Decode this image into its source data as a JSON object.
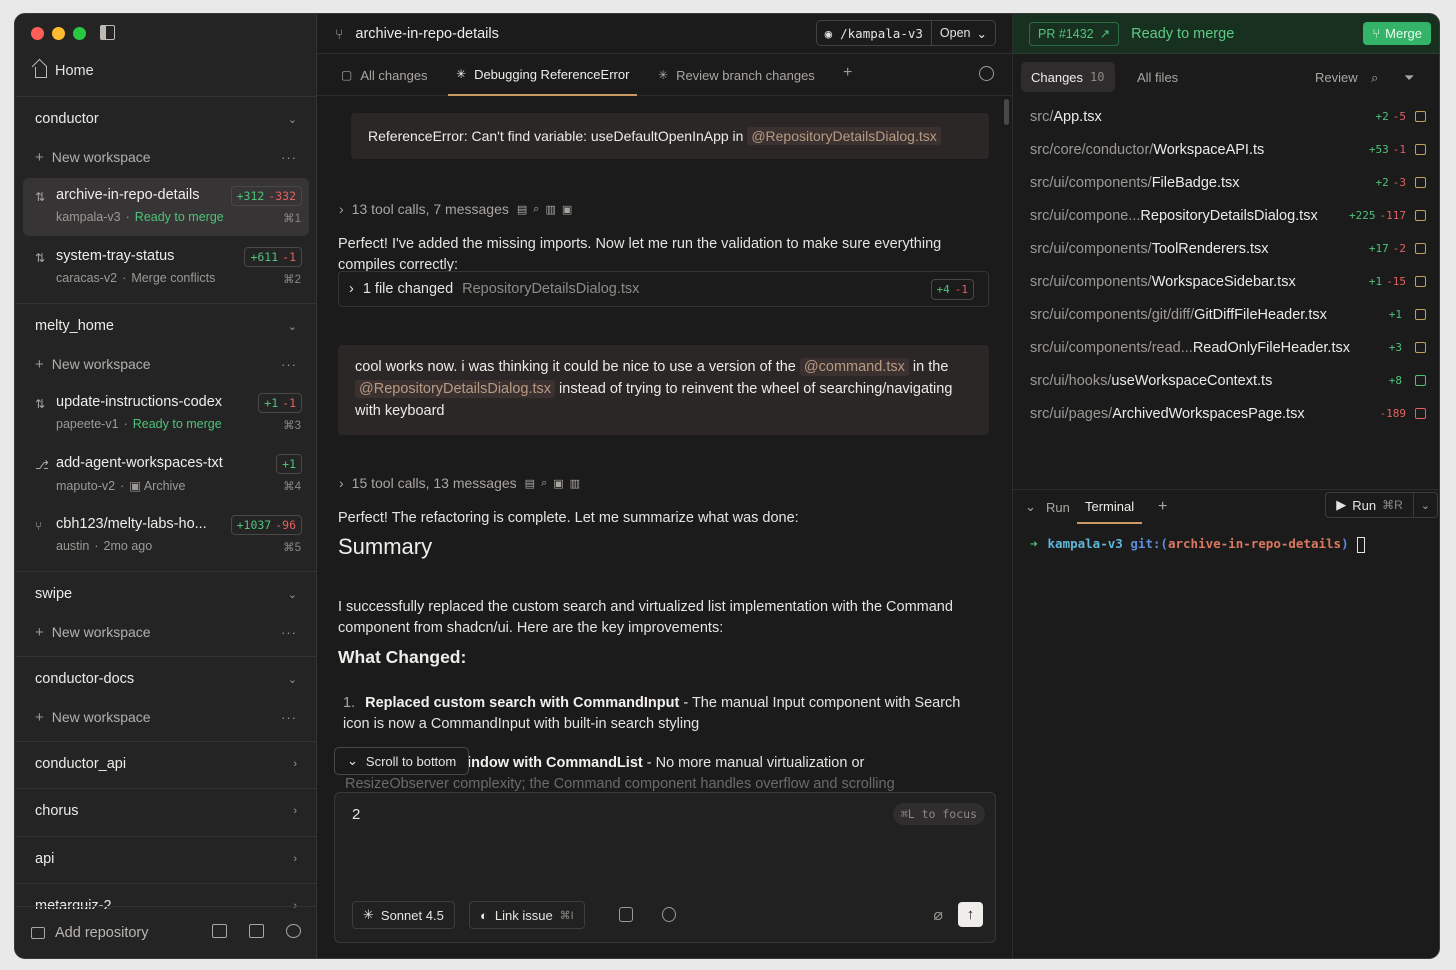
{
  "sidebar": {
    "home_label": "Home",
    "repos": [
      {
        "name": "conductor",
        "new_workspace": "New workspace",
        "workspaces": [
          {
            "title": "archive-in-repo-details",
            "sub": "kampala-v3",
            "status": "Ready to merge",
            "add": "+312",
            "del": "-332",
            "shortcut": "⌘1"
          },
          {
            "title": "system-tray-status",
            "sub": "caracas-v2",
            "status": "Merge conflicts",
            "add": "+611",
            "del": "-1",
            "shortcut": "⌘2"
          }
        ]
      },
      {
        "name": "melty_home",
        "new_workspace": "New workspace",
        "workspaces": [
          {
            "title": "update-instructions-codex",
            "sub": "papeete-v1",
            "status": "Ready to merge",
            "add": "+1",
            "del": "-1",
            "shortcut": "⌘3"
          },
          {
            "title": "add-agent-workspaces-txt",
            "sub": "maputo-v2",
            "status": "Archive",
            "add": "+1",
            "shortcut": "⌘4"
          },
          {
            "title": "cbh123/melty-labs-ho...",
            "sub": "austin",
            "status": "2mo ago",
            "add": "+1037",
            "del": "-96",
            "shortcut": "⌘5"
          }
        ]
      },
      {
        "name": "swipe",
        "new_workspace": "New workspace"
      },
      {
        "name": "conductor-docs",
        "new_workspace": "New workspace"
      },
      {
        "name": "conductor_api"
      },
      {
        "name": "chorus"
      },
      {
        "name": "api"
      },
      {
        "name": "metarquiz-2"
      }
    ],
    "add_repository": "Add repository"
  },
  "middle": {
    "title": "archive-in-repo-details",
    "branch": "/kampala-v3",
    "open_label": "Open",
    "tabs": [
      "All changes",
      "Debugging ReferenceError",
      "Review branch changes"
    ],
    "error_text": "ReferenceError: Can't find variable: useDefaultOpenInApp in",
    "error_ref": "@RepositoryDetailsDialog.tsx",
    "toolcalls_1": "13 tool calls, 7 messages",
    "assistant_1": "Perfect! I've added the missing imports. Now let me run the validation to make sure everything compiles correctly:",
    "file_changed": "1 file changed",
    "file_changed_name": "RepositoryDetailsDialog.tsx",
    "file_changed_add": "+4",
    "file_changed_del": "-1",
    "user_msg_1": "cool works now. i was thinking it could be nice to use a version of the",
    "user_ref_1": "@command.tsx",
    "user_msg_2": "in the",
    "user_ref_2": "@RepositoryDetailsDialog.tsx",
    "user_msg_3": "instead of trying to reinvent the wheel of searching/navigating with keyboard",
    "toolcalls_2": "15 tool calls, 13 messages",
    "assistant_2": "Perfect! The refactoring is complete. Let me summarize what was done:",
    "summary_heading": "Summary",
    "summary_text": "I successfully replaced the custom search and virtualized list implementation with the Command component from shadcn/ui. Here are the key improvements:",
    "what_changed": "What Changed:",
    "li1_num": "1.",
    "li1_bold": "Replaced custom search with CommandInput",
    "li1_text": " - The manual Input component with Search icon is now a CommandInput with built-in search styling",
    "li2_bold": "-window with CommandList",
    "li2_text": " - No more manual virtualization or",
    "li2_fade": "ResizeObserver complexity; the Command component handles overflow and scrolling",
    "scroll_to_bottom": "Scroll to bottom",
    "composer_text": "2",
    "focus_hint": "⌘L to focus",
    "model": "Sonnet 4.5",
    "link_issue": "Link issue",
    "link_issue_kb": "⌘I"
  },
  "right": {
    "pr_label": "PR #1432",
    "pr_status": "Ready to merge",
    "merge_label": "Merge",
    "tab_changes": "Changes",
    "tab_changes_count": "10",
    "tab_all_files": "All files",
    "review_label": "Review",
    "files": [
      {
        "dir": "src/",
        "name": "App.tsx",
        "add": "+2",
        "del": "-5",
        "state": "modified"
      },
      {
        "dir": "src/core/conductor/",
        "name": "WorkspaceAPI.ts",
        "add": "+53",
        "del": "-1",
        "state": "modified"
      },
      {
        "dir": "src/ui/components/",
        "name": "FileBadge.tsx",
        "add": "+2",
        "del": "-3",
        "state": "modified"
      },
      {
        "dir": "src/ui/compone...",
        "name": " RepositoryDetailsDialog.tsx",
        "add": "+225",
        "del": "-117",
        "state": "modified"
      },
      {
        "dir": "src/ui/components/",
        "name": "ToolRenderers.tsx",
        "add": "+17",
        "del": "-2",
        "state": "modified"
      },
      {
        "dir": "src/ui/components/",
        "name": "WorkspaceSidebar.tsx",
        "add": "+1",
        "del": "-15",
        "state": "modified"
      },
      {
        "dir": "src/ui/components/git/diff/",
        "name": "GitDiffFileHeader.tsx",
        "add": "+1",
        "del": "",
        "state": "modified"
      },
      {
        "dir": "src/ui/components/read...",
        "name": " ReadOnlyFileHeader.tsx",
        "add": "+3",
        "del": "",
        "state": "modified"
      },
      {
        "dir": "src/ui/hooks/",
        "name": "useWorkspaceContext.ts",
        "add": "+8",
        "del": "",
        "state": "added"
      },
      {
        "dir": "src/ui/pages/",
        "name": "ArchivedWorkspacesPage.tsx",
        "add": "",
        "del": "-189",
        "state": "deleted"
      }
    ],
    "terminal_tabs": [
      "Run",
      "Terminal"
    ],
    "run_label": "Run",
    "run_kb": "⌘R",
    "term_dir": "kampala-v3",
    "term_git": "git:(",
    "term_branch": "archive-in-repo-details",
    "term_close": ")"
  },
  "colors": {
    "ready": "#4ec27a",
    "added": "#4ec27a",
    "deleted": "#e46060",
    "accent_tab": "#c89a64",
    "merge_bg": "#34b468"
  }
}
